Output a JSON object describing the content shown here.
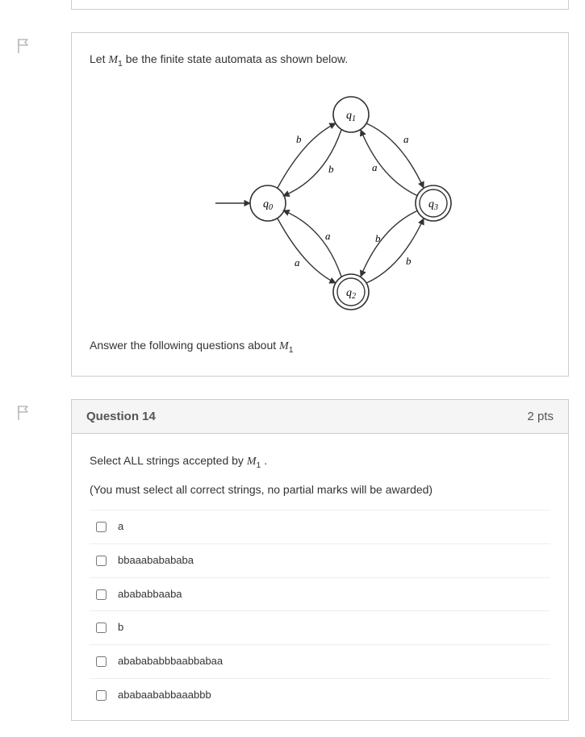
{
  "intro": {
    "line1_pre": "Let ",
    "line1_var": "M",
    "line1_sub": "1",
    "line1_post": " be the finite state automata as shown below.",
    "line2_pre": "Answer the following questions about ",
    "line2_var": "M",
    "line2_sub": "1"
  },
  "diagram": {
    "states": {
      "q0": "q0",
      "q1": "q1",
      "q2": "q2",
      "q3": "q3"
    },
    "edge_a": "a",
    "edge_b": "b"
  },
  "question": {
    "title": "Question 14",
    "points": "2 pts",
    "prompt_pre": "Select ALL strings accepted by ",
    "prompt_var": "M",
    "prompt_sub": "1",
    "prompt_post": " .",
    "note": "(You must select all correct strings, no partial marks will be awarded)",
    "choices": [
      "a",
      "bbaaababababa",
      "abababbaaba",
      "b",
      "ababababbbaabbabaa",
      "ababaababbaaabbb"
    ]
  }
}
